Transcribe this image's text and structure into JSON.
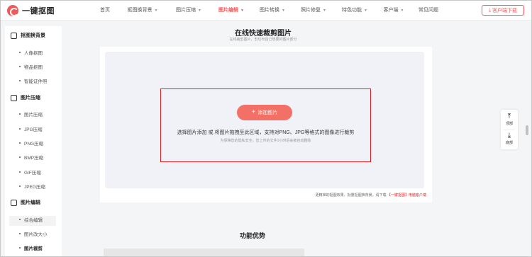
{
  "header": {
    "logo_text": "一键抠图",
    "nav": [
      {
        "label": "首页",
        "dropdown": false,
        "active": false
      },
      {
        "label": "抠图换背景",
        "dropdown": true,
        "active": false
      },
      {
        "label": "图片压缩",
        "dropdown": true,
        "active": false
      },
      {
        "label": "图片编辑",
        "dropdown": true,
        "active": true
      },
      {
        "label": "图片转换",
        "dropdown": true,
        "active": false
      },
      {
        "label": "照片修复",
        "dropdown": true,
        "active": false
      },
      {
        "label": "特色功能",
        "dropdown": true,
        "active": false
      },
      {
        "label": "客户端",
        "dropdown": true,
        "active": false
      },
      {
        "label": "常见问题",
        "dropdown": false,
        "active": false
      }
    ],
    "download_label": "客户端下载"
  },
  "sidebar": {
    "groups": [
      {
        "title": "抠图换背景",
        "icon": "crop-frame-icon",
        "items": [
          "人像抠图",
          "物品抠图",
          "智能证件照"
        ]
      },
      {
        "title": "图片压缩",
        "icon": "compress-icon",
        "items": [
          "图片压缩",
          "JPG压缩",
          "PNG压缩",
          "BMP压缩",
          "GIF压缩",
          "JPEG压缩"
        ]
      },
      {
        "title": "图片编辑",
        "icon": "image-edit-icon",
        "items": [
          "综合编辑",
          "图片改大小",
          "图片裁剪"
        ]
      }
    ],
    "active_item": "图片裁剪"
  },
  "main": {
    "title": "在线快速裁剪图片",
    "subtitle": "在线裁剪图片，剪切出自己想要的图片部分",
    "add_button": "添加图片",
    "upload_desc": "选择图片添加 或 将图片拖拽至此区域，支持对PNG、JPG等格式的图像进行裁剪",
    "upload_note": "为保障您的隐私安全，您上传的文件1小时后会被自动删除",
    "promo_text": "更精准的抠图效果、批量抠图换背景，请下载",
    "promo_link": "【一键抠图】电脑客户端",
    "section_title": "功能优势"
  },
  "float": {
    "top_label": "顶部",
    "bottom_label": "底部"
  },
  "colors": {
    "accent": "#f05a5a",
    "button": "#f27066",
    "highlight_border": "#e02020"
  }
}
